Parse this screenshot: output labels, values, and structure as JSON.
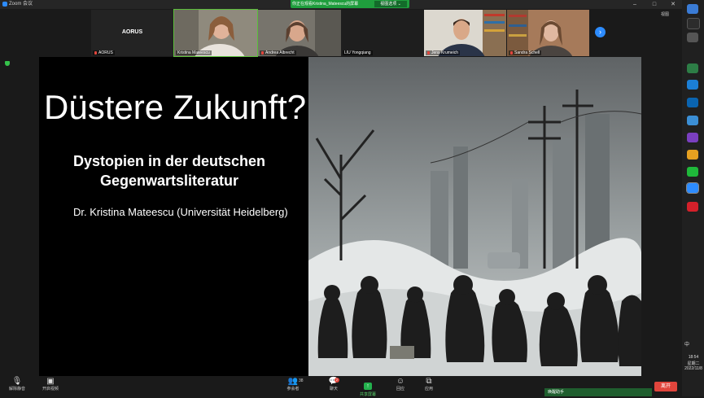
{
  "window": {
    "title": "Zoom 会议",
    "controls": [
      "–",
      "□",
      "✕"
    ]
  },
  "share_banner": {
    "text": "你正在观看Kristina_Mateescu的屏幕",
    "view_options": "视图选项 ⌄"
  },
  "gallery": {
    "view_label": "视图",
    "participants": [
      {
        "name": "AORUS",
        "display": "AORUS",
        "muted": true
      },
      {
        "name": "Kristina Mateescu",
        "muted": false
      },
      {
        "name": "Andrea Albrecht",
        "muted": true
      },
      {
        "name": "LIU Yongqiang",
        "muted": false
      },
      {
        "name": "Jens Krumeich",
        "muted": true
      },
      {
        "name": "Sandra Schell",
        "muted": true
      }
    ]
  },
  "slide": {
    "title": "Düstere Zukunft?",
    "subtitle_line1": "Dystopien in der deutschen",
    "subtitle_line2": "Gegenwartsliteratur",
    "author": "Dr. Kristina Mateescu (Universität Heidelberg)"
  },
  "toolbar": {
    "unmute": "解除静音",
    "video": "开启视频",
    "participants": "参会者",
    "participants_count": "38",
    "chat": "聊天",
    "chat_badge": "2",
    "share": "共享屏幕",
    "reactions": "回应",
    "apps": "应用",
    "leave": "离开"
  },
  "helper": {
    "label": "唤醒助手"
  },
  "taskbar": {
    "ime": "中",
    "time": "18:54",
    "weekday": "星期二",
    "date": "2022/11/8"
  },
  "colors": {
    "accent_green": "#23b14d",
    "zoom_blue": "#2d8cff",
    "leave_red": "#e0453c"
  }
}
